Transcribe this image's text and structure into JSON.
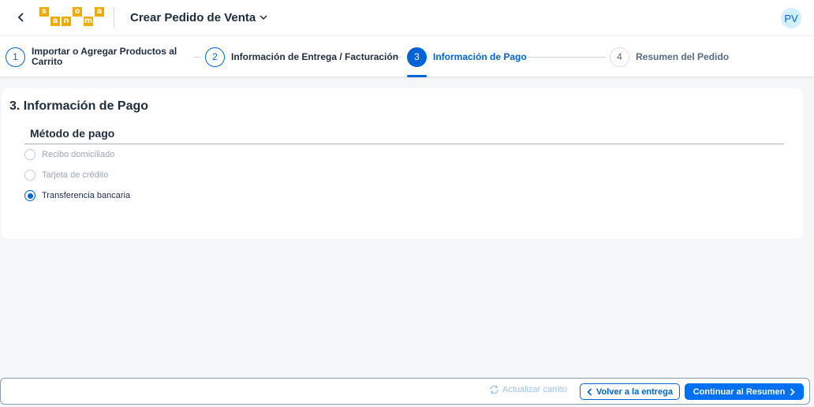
{
  "header": {
    "logo_letters_top": [
      "s",
      "o",
      "a"
    ],
    "logo_letters_bottom": [
      "a",
      "n",
      "m"
    ],
    "app_title": "Crear Pedido de Venta",
    "avatar_initials": "PV"
  },
  "steps": [
    {
      "number": "1",
      "label_line1": "Importar o Agregar Productos al",
      "label_line2": "Carrito",
      "state": "done"
    },
    {
      "number": "2",
      "label_line1": "Información de Entrega / Facturación",
      "label_line2": "",
      "state": "done"
    },
    {
      "number": "3",
      "label_line1": "Información de Pago",
      "label_line2": "",
      "state": "active"
    },
    {
      "number": "4",
      "label_line1": "Resumen del Pedido",
      "label_line2": "",
      "state": "future"
    }
  ],
  "payment": {
    "section_title": "3. Información de Pago",
    "group_title": "Método de pago",
    "options": [
      {
        "label": "Recibo domiciliado",
        "selected": false,
        "enabled": false
      },
      {
        "label": "Tarjeta de crédito",
        "selected": false,
        "enabled": false
      },
      {
        "label": "Transferencia bancaria",
        "selected": true,
        "enabled": true
      }
    ]
  },
  "footer": {
    "refresh_label": "Actualizar carrito",
    "back_label": "Volver a la entrega",
    "next_label": "Continuar al Resumen"
  },
  "colors": {
    "accent": "#0064d9",
    "brand_logo": "#f0ab00",
    "primary_button": "#0070f2"
  }
}
